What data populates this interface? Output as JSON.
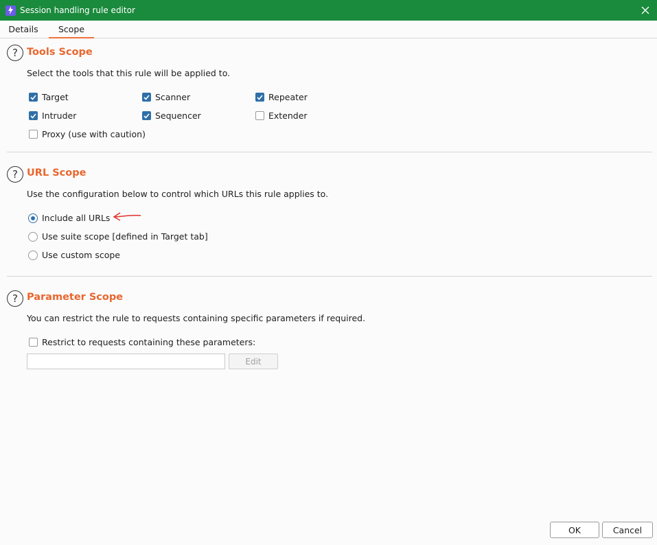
{
  "window": {
    "title": "Session handling rule editor",
    "icon": "burp-lightning-icon",
    "accent": "#1a8a3c"
  },
  "tabs": [
    {
      "label": "Details",
      "active": false
    },
    {
      "label": "Scope",
      "active": true
    }
  ],
  "tools_scope": {
    "title": "Tools Scope",
    "description": "Select the tools that this rule will be applied to.",
    "tools": [
      {
        "label": "Target",
        "checked": true
      },
      {
        "label": "Scanner",
        "checked": true
      },
      {
        "label": "Repeater",
        "checked": true
      },
      {
        "label": "Intruder",
        "checked": true
      },
      {
        "label": "Sequencer",
        "checked": true
      },
      {
        "label": "Extender",
        "checked": false
      },
      {
        "label": "Proxy (use with caution)",
        "checked": false
      }
    ]
  },
  "url_scope": {
    "title": "URL Scope",
    "description": "Use the configuration below to control which URLs this rule applies to.",
    "options": [
      {
        "label": "Include all URLs",
        "selected": true
      },
      {
        "label": "Use suite scope [defined in Target tab]",
        "selected": false
      },
      {
        "label": "Use custom scope",
        "selected": false
      }
    ]
  },
  "parameter_scope": {
    "title": "Parameter Scope",
    "description": "You can restrict the rule to requests containing specific parameters if required.",
    "restrict_label": "Restrict to requests containing these parameters:",
    "restrict_checked": false,
    "input_value": "",
    "edit_label": "Edit"
  },
  "footer": {
    "ok_label": "OK",
    "cancel_label": "Cancel"
  },
  "colors": {
    "section_title": "#e8672f",
    "checked": "#2f6fa8",
    "annotation_arrow": "#e0312b"
  }
}
